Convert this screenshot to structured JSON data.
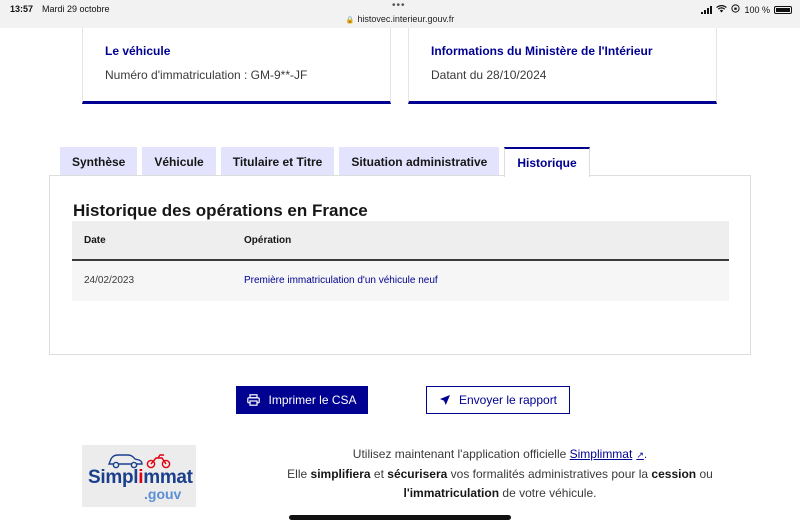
{
  "status_bar": {
    "time": "13:57",
    "date": "Mardi 29 octobre",
    "url": "histovec.interieur.gouv.fr",
    "battery": "100 %"
  },
  "cards": [
    {
      "title": "Le véhicule",
      "text": "Numéro d'immatriculation : GM-9**-JF"
    },
    {
      "title": "Informations du Ministère de l'Intérieur",
      "text": "Datant du 28/10/2024"
    }
  ],
  "tabs": [
    {
      "label": "Synthèse",
      "active": false
    },
    {
      "label": "Véhicule",
      "active": false
    },
    {
      "label": "Titulaire et Titre",
      "active": false
    },
    {
      "label": "Situation administrative",
      "active": false
    },
    {
      "label": "Historique",
      "active": true
    }
  ],
  "panel": {
    "title": "Historique des opérations en France",
    "columns": [
      "Date",
      "Opération"
    ],
    "rows": [
      {
        "date": "24/02/2023",
        "operation": "Première immatriculation d'un véhicule neuf"
      }
    ]
  },
  "buttons": {
    "print_label": "Imprimer le CSA",
    "send_label": "Envoyer le rapport"
  },
  "logo": {
    "word_a": "Simpl",
    "word_b": "i",
    "word_c": "mmat",
    "suffix": ".gouv"
  },
  "promo": {
    "l1_a": "Utilisez maintenant l'application officielle",
    "l1_link": "Simplimmat",
    "l1_end": ".",
    "l2_a": "Elle",
    "l2_b": "simplifiera",
    "l2_c": "et",
    "l2_d": "sécurisera",
    "l2_e": "vos formalités administratives pour la",
    "l2_f": "cession",
    "l2_g": "ou",
    "l3_a": "l'immatriculation",
    "l3_b": "de votre véhicule."
  },
  "colors": {
    "primary": "#000091",
    "tab_bg": "#e3e3fd",
    "table_header_bg": "#eeeeee",
    "logo_red": "#e1000f"
  },
  "icons": [
    "lock-icon",
    "signal-icon",
    "wifi-icon",
    "battery-icon",
    "printer-icon",
    "send-arrow-icon",
    "external-link-icon",
    "car-icon",
    "motorbike-icon"
  ]
}
